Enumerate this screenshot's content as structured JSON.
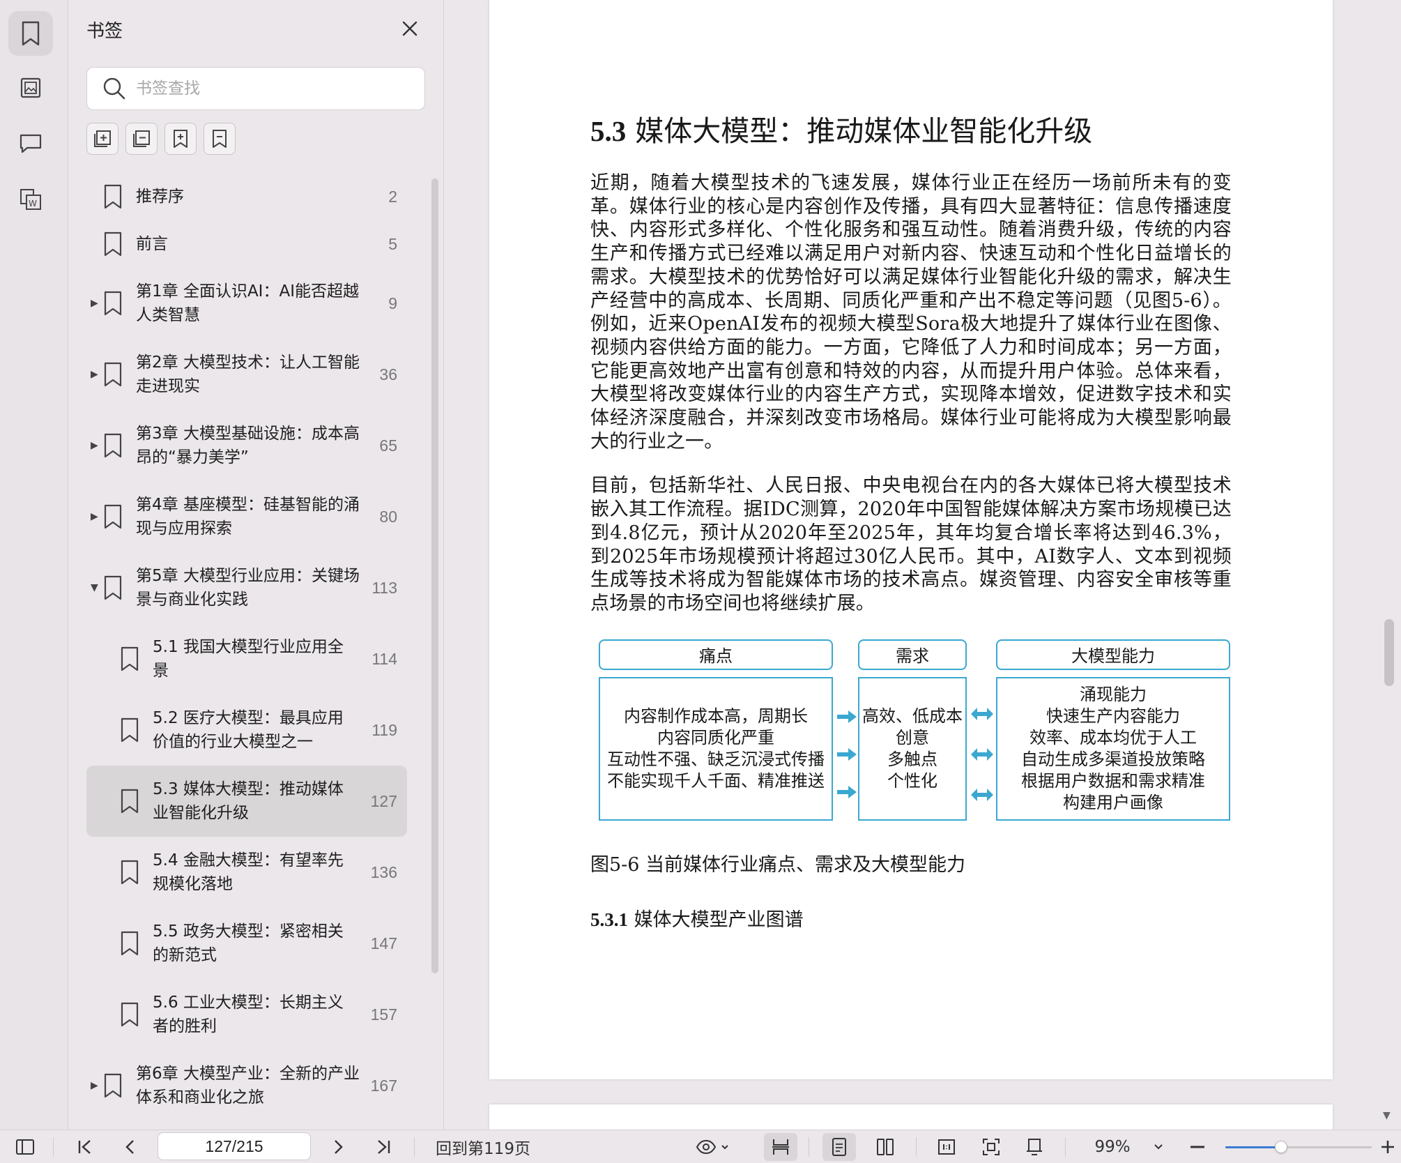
{
  "sidebar_panel": {
    "title": "书签",
    "search_placeholder": "书签查找"
  },
  "bookmarks": [
    {
      "label": "推荐序",
      "page": "2",
      "level": 0,
      "expandable": false
    },
    {
      "label": "前言",
      "page": "5",
      "level": 0,
      "expandable": false
    },
    {
      "label": "第1章 全面认识AI：AI能否超越人类智慧",
      "page": "9",
      "level": 0,
      "expandable": true,
      "expanded": false
    },
    {
      "label": "第2章 大模型技术：让人工智能走进现实",
      "page": "36",
      "level": 0,
      "expandable": true,
      "expanded": false
    },
    {
      "label": "第3章 大模型基础设施：成本高昂的“暴力美学”",
      "page": "65",
      "level": 0,
      "expandable": true,
      "expanded": false
    },
    {
      "label": "第4章 基座模型：硅基智能的涌现与应用探索",
      "page": "80",
      "level": 0,
      "expandable": true,
      "expanded": false
    },
    {
      "label": "第5章 大模型行业应用：关键场景与商业化实践",
      "page": "113",
      "level": 0,
      "expandable": true,
      "expanded": true
    },
    {
      "label": "5.1 我国大模型行业应用全景",
      "page": "114",
      "level": 1,
      "expandable": false
    },
    {
      "label": "5.2 医疗大模型：最具应用价值的行业大模型之一",
      "page": "119",
      "level": 1,
      "expandable": false
    },
    {
      "label": "5.3 媒体大模型：推动媒体业智能化升级",
      "page": "127",
      "level": 1,
      "expandable": false,
      "selected": true
    },
    {
      "label": "5.4 金融大模型：有望率先规模化落地",
      "page": "136",
      "level": 1,
      "expandable": false
    },
    {
      "label": "5.5 政务大模型：紧密相关的新范式",
      "page": "147",
      "level": 1,
      "expandable": false
    },
    {
      "label": "5.6 工业大模型：长期主义者的胜利",
      "page": "157",
      "level": 1,
      "expandable": false
    },
    {
      "label": "第6章 大模型产业：全新的产业体系和商业化之旅",
      "page": "167",
      "level": 0,
      "expandable": true,
      "expanded": false
    }
  ],
  "document": {
    "heading_num": "5.3",
    "heading_text": "媒体大模型：推动媒体业智能化升级",
    "para1": "近期，随着大模型技术的飞速发展，媒体行业正在经历一场前所未有的变革。媒体行业的核心是内容创作及传播，具有四大显著特征：信息传播速度快、内容形式多样化、个性化服务和强互动性。随着消费升级，传统的内容生产和传播方式已经难以满足用户对新内容、快速互动和个性化日益增长的需求。大模型技术的优势恰好可以满足媒体行业智能化升级的需求，解决生产经营中的高成本、长周期、同质化严重和产出不稳定等问题（见图5-6）。例如，近来OpenAI发布的视频大模型Sora极大地提升了媒体行业在图像、视频内容供给方面的能力。一方面，它降低了人力和时间成本；另一方面，它能更高效地产出富有创意和特效的内容，从而提升用户体验。总体来看，大模型将改变媒体行业的内容生产方式，实现降本增效，促进数字技术和实体经济深度融合，并深刻改变市场格局。媒体行业可能将成为大模型影响最大的行业之一。",
    "para2": "目前，包括新华社、人民日报、中央电视台在内的各大媒体已将大模型技术嵌入其工作流程。据IDC测算，2020年中国智能媒体解决方案市场规模已达到4.8亿元，预计从2020年至2025年，其年均复合增长率将达到46.3%，到2025年市场规模预计将超过30亿人民币。其中，AI数字人、文本到视频生成等技术将成为智能媒体市场的技术高点。媒资管理、内容安全审核等重点场景的市场空间也将继续扩展。",
    "figure": {
      "col1_title": "痛点",
      "col2_title": "需求",
      "col3_title": "大模型能力",
      "col1_lines": [
        "内容制作成本高，周期长",
        "内容同质化严重",
        "互动性不强、缺乏沉浸式传播",
        "不能实现千人千面、精准推送"
      ],
      "col2_lines": [
        "高效、低成本",
        "创意",
        "多触点",
        "个性化"
      ],
      "col3_lines": [
        "涌现能力",
        "快速生产内容能力",
        "效率、成本均优于人工",
        "自动生成多渠道投放策略",
        "根据用户数据和需求精准",
        "构建用户画像"
      ]
    },
    "caption": "图5-6 当前媒体行业痛点、需求及大模型能力",
    "subheading_num": "5.3.1",
    "subheading_text": "媒体大模型产业图谱"
  },
  "bottombar": {
    "page_value": "127/215",
    "back_to": "回到第119页",
    "zoom": "99%",
    "zoom_level": 0.38
  },
  "colors": {
    "accent": "#3a7bd5",
    "figure_border": "#3aa8d0"
  }
}
